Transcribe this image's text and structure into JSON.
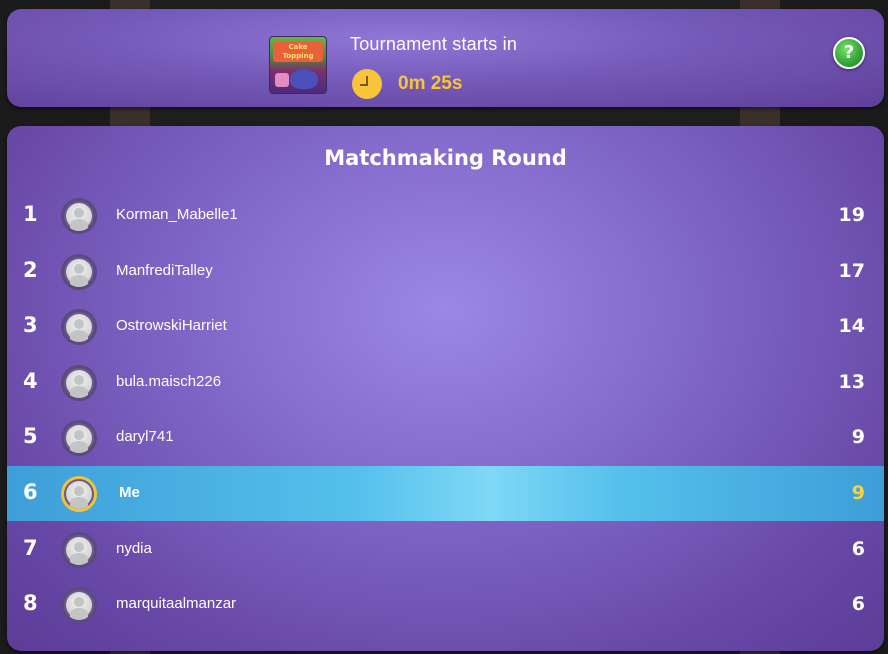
{
  "header": {
    "tournament_label": "Tournament starts in",
    "countdown": "0m 25s",
    "game_thumbnail_text": "Cake Topping",
    "help_symbol": "?",
    "clock_icon": "clock-icon",
    "help_icon": "help-icon"
  },
  "leaderboard": {
    "title": "Matchmaking Round",
    "players": [
      {
        "rank": "1",
        "name": "Korman_Mabelle1",
        "score": "19",
        "is_me": false
      },
      {
        "rank": "2",
        "name": "ManfrediTalley",
        "score": "17",
        "is_me": false
      },
      {
        "rank": "3",
        "name": "OstrowskiHarriet",
        "score": "14",
        "is_me": false
      },
      {
        "rank": "4",
        "name": "bula.maisch226",
        "score": "13",
        "is_me": false
      },
      {
        "rank": "5",
        "name": "daryl741",
        "score": "9",
        "is_me": false
      },
      {
        "rank": "6",
        "name": "Me",
        "score": "9",
        "is_me": true
      },
      {
        "rank": "7",
        "name": "nydia",
        "score": "6",
        "is_me": false
      },
      {
        "rank": "8",
        "name": "marquitaalmanzar",
        "score": "6",
        "is_me": false
      }
    ]
  },
  "colors": {
    "panel": "#7559b8",
    "highlight_row": "#55c0ec",
    "accent_gold": "#f8c53a",
    "help_green": "#36a83a"
  }
}
